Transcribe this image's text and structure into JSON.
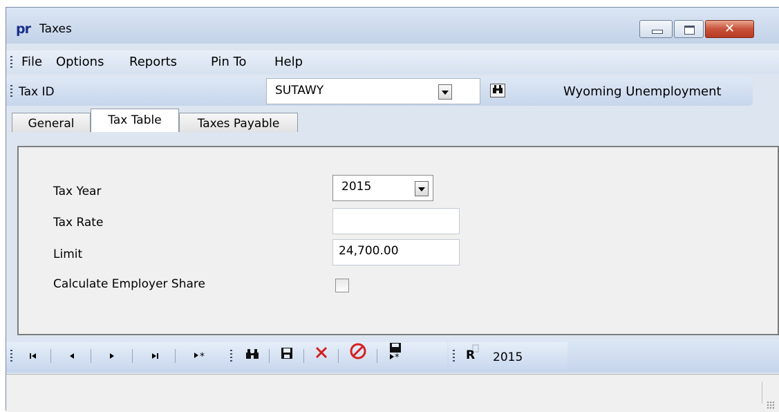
{
  "window": {
    "app_icon": "pr",
    "title": "Taxes",
    "buttons": {
      "minimize": "minimize-icon",
      "maximize": "maximize-icon",
      "close": "✕"
    }
  },
  "menu": {
    "items": [
      "File",
      "Options",
      "Reports",
      "Pin To",
      "Help"
    ]
  },
  "taxbar": {
    "label": "Tax ID",
    "value": "SUTAWY",
    "description": "Wyoming Unemployment"
  },
  "tabs": [
    {
      "label": "General",
      "active": false
    },
    {
      "label": "Tax Table",
      "active": true
    },
    {
      "label": "Taxes Payable",
      "active": false
    }
  ],
  "form": {
    "tax_year": {
      "label": "Tax Year",
      "value": "2015"
    },
    "tax_rate": {
      "label": "Tax Rate",
      "value": ""
    },
    "limit": {
      "label": "Limit",
      "value": "24,700.00"
    },
    "employer_share": {
      "label": "Calculate Employer Share",
      "checked": false
    }
  },
  "navbar": {
    "first": "first-record-icon",
    "prev": "previous-record-icon",
    "next": "next-record-icon",
    "last": "last-record-icon",
    "new": "new-record-icon",
    "find": "binoculars-icon",
    "save": "save-icon",
    "delete": "delete-icon",
    "cancel": "cancel-icon",
    "save_new": "save-new-icon",
    "report": "report-icon",
    "year": "2015"
  },
  "colors": {
    "accent_blue": "#1a2f8a",
    "delete_red": "#d42020",
    "close_red": "#c8523a"
  }
}
